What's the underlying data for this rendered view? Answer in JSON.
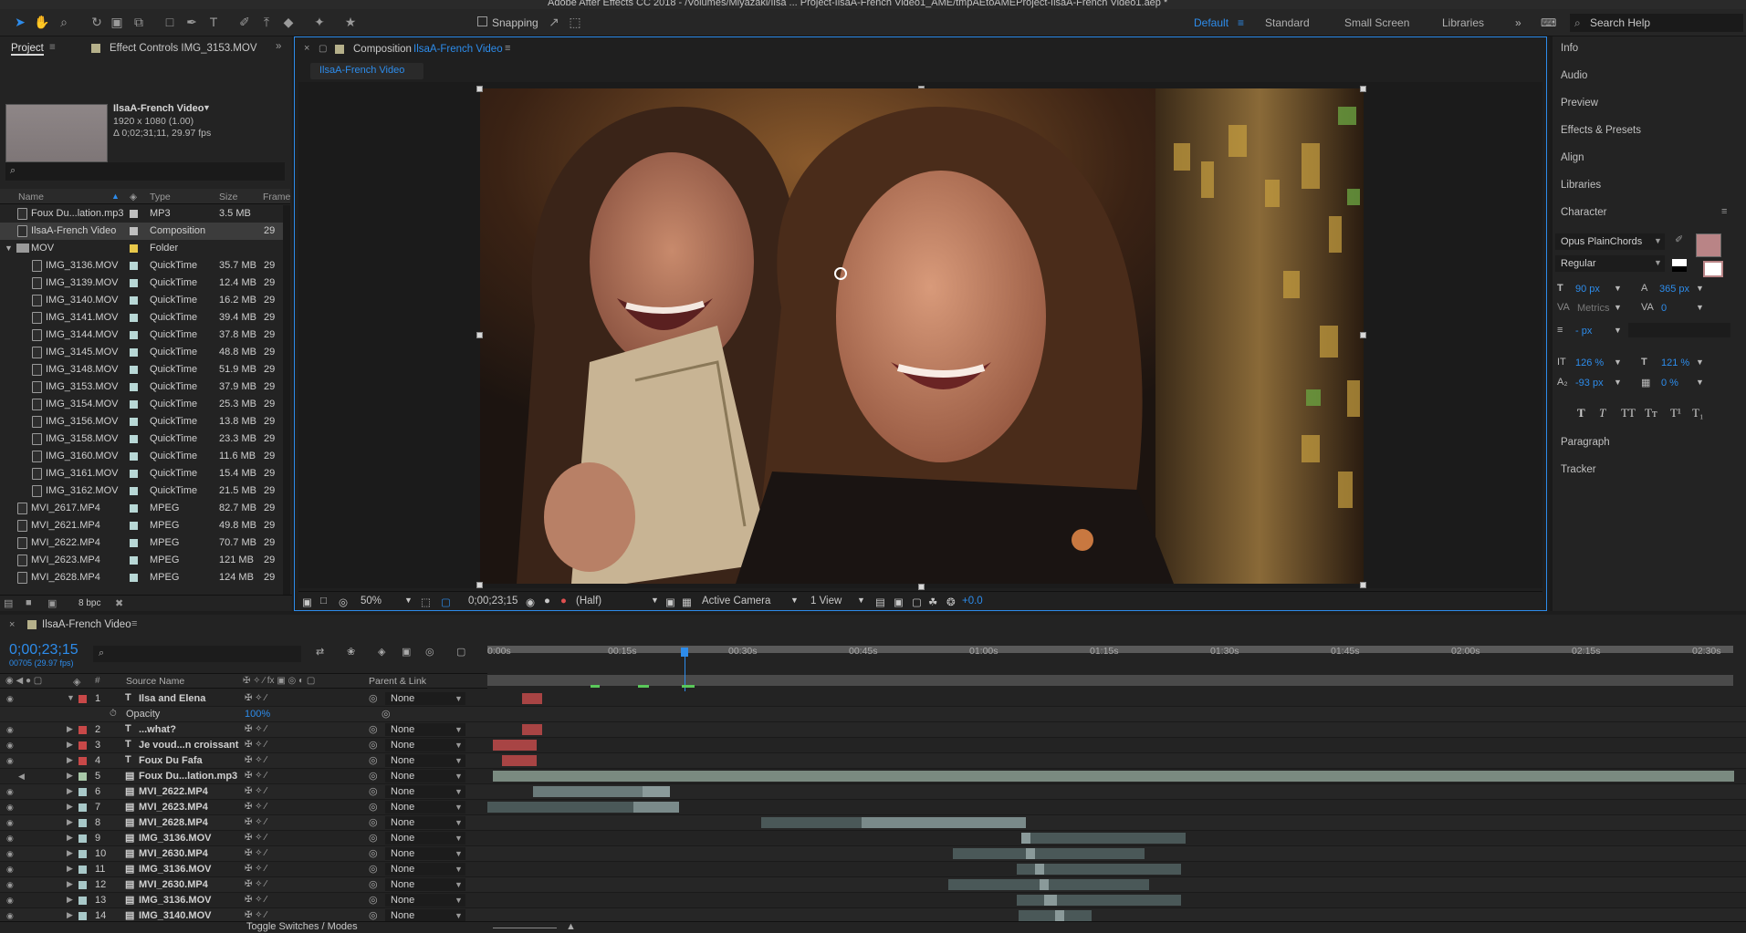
{
  "window_title": "Adobe After Effects CC 2018 - /Volumes/Miyazaki/Ilsa ... Project-IlsaA-French Video1_AME/tmpAEtoAMEProject-IlsaA-French Video1.aep *",
  "toolbar": {
    "snapping_label": "Snapping"
  },
  "workspaces": {
    "items": [
      "Default",
      "Standard",
      "Small Screen",
      "Libraries"
    ],
    "active": "Default"
  },
  "search_help": "Search Help",
  "project": {
    "tab_project": "Project",
    "tab_effect_controls": "Effect Controls IMG_3153.MOV",
    "selected_name": "IlsaA-French Video",
    "selected_dims": "1920 x 1080 (1.00)",
    "selected_duration": "Δ 0;02;31;11, 29.97 fps",
    "columns": {
      "name": "Name",
      "type": "Type",
      "size": "Size",
      "frame": "Frame"
    },
    "bpc": "8 bpc",
    "items": [
      {
        "name": "Foux Du...lation.mp3",
        "type": "MP3",
        "size": "3.5 MB",
        "frame": "",
        "color": "#bfbfbf",
        "indent": 0
      },
      {
        "name": "IlsaA-French Video",
        "type": "Composition",
        "size": "",
        "frame": "29",
        "color": "#bfbfbf",
        "indent": 0,
        "selected": true
      },
      {
        "name": "MOV",
        "type": "Folder",
        "size": "",
        "frame": "",
        "color": "#e8c84a",
        "indent": 0,
        "folder": true
      },
      {
        "name": "IMG_3136.MOV",
        "type": "QuickTime",
        "size": "35.7 MB",
        "frame": "29",
        "color": "#b8d8d6",
        "indent": 1
      },
      {
        "name": "IMG_3139.MOV",
        "type": "QuickTime",
        "size": "12.4 MB",
        "frame": "29",
        "color": "#b8d8d6",
        "indent": 1
      },
      {
        "name": "IMG_3140.MOV",
        "type": "QuickTime",
        "size": "16.2 MB",
        "frame": "29",
        "color": "#b8d8d6",
        "indent": 1
      },
      {
        "name": "IMG_3141.MOV",
        "type": "QuickTime",
        "size": "39.4 MB",
        "frame": "29",
        "color": "#b8d8d6",
        "indent": 1
      },
      {
        "name": "IMG_3144.MOV",
        "type": "QuickTime",
        "size": "37.8 MB",
        "frame": "29",
        "color": "#b8d8d6",
        "indent": 1
      },
      {
        "name": "IMG_3145.MOV",
        "type": "QuickTime",
        "size": "48.8 MB",
        "frame": "29",
        "color": "#b8d8d6",
        "indent": 1
      },
      {
        "name": "IMG_3148.MOV",
        "type": "QuickTime",
        "size": "51.9 MB",
        "frame": "29",
        "color": "#b8d8d6",
        "indent": 1
      },
      {
        "name": "IMG_3153.MOV",
        "type": "QuickTime",
        "size": "37.9 MB",
        "frame": "29",
        "color": "#b8d8d6",
        "indent": 1
      },
      {
        "name": "IMG_3154.MOV",
        "type": "QuickTime",
        "size": "25.3 MB",
        "frame": "29",
        "color": "#b8d8d6",
        "indent": 1
      },
      {
        "name": "IMG_3156.MOV",
        "type": "QuickTime",
        "size": "13.8 MB",
        "frame": "29",
        "color": "#b8d8d6",
        "indent": 1
      },
      {
        "name": "IMG_3158.MOV",
        "type": "QuickTime",
        "size": "23.3 MB",
        "frame": "29",
        "color": "#b8d8d6",
        "indent": 1
      },
      {
        "name": "IMG_3160.MOV",
        "type": "QuickTime",
        "size": "11.6 MB",
        "frame": "29",
        "color": "#b8d8d6",
        "indent": 1
      },
      {
        "name": "IMG_3161.MOV",
        "type": "QuickTime",
        "size": "15.4 MB",
        "frame": "29",
        "color": "#b8d8d6",
        "indent": 1
      },
      {
        "name": "IMG_3162.MOV",
        "type": "QuickTime",
        "size": "21.5 MB",
        "frame": "29",
        "color": "#b8d8d6",
        "indent": 1
      },
      {
        "name": "MVI_2617.MP4",
        "type": "MPEG",
        "size": "82.7 MB",
        "frame": "29",
        "color": "#b8d8d6",
        "indent": 0
      },
      {
        "name": "MVI_2621.MP4",
        "type": "MPEG",
        "size": "49.8 MB",
        "frame": "29",
        "color": "#b8d8d6",
        "indent": 0
      },
      {
        "name": "MVI_2622.MP4",
        "type": "MPEG",
        "size": "70.7 MB",
        "frame": "29",
        "color": "#b8d8d6",
        "indent": 0
      },
      {
        "name": "MVI_2623.MP4",
        "type": "MPEG",
        "size": "121 MB",
        "frame": "29",
        "color": "#b8d8d6",
        "indent": 0
      },
      {
        "name": "MVI_2628.MP4",
        "type": "MPEG",
        "size": "124 MB",
        "frame": "29",
        "color": "#b8d8d6",
        "indent": 0
      }
    ]
  },
  "composition": {
    "tab_prefix": "Composition",
    "name": "IlsaA-French Video",
    "breadcrumb": "IlsaA-French Video",
    "zoom": "50%",
    "timecode": "0;00;23;15",
    "resolution": "(Half)",
    "camera": "Active Camera",
    "views": "1 View",
    "exposure": "+0.0"
  },
  "right_panel": {
    "items": [
      "Info",
      "Audio",
      "Preview",
      "Effects & Presets",
      "Align",
      "Libraries",
      "Character",
      "Paragraph",
      "Tracker"
    ],
    "character": {
      "font": "Opus PlainChords",
      "style": "Regular",
      "font_size": "90 px",
      "leading": "365 px",
      "kerning": "Metrics",
      "tracking": "0",
      "stroke": "- px",
      "vert_scale": "126 %",
      "horiz_scale": "121 %",
      "baseline": "-93 px",
      "tsume": "0 %",
      "fill_color": "#b98486"
    }
  },
  "timeline": {
    "tab": "IlsaA-French Video",
    "timecode": "0;00;23;15",
    "frames": "00705 (29.97 fps)",
    "col_source": "Source Name",
    "col_parent": "Parent & Link",
    "toggle_label": "Toggle Switches / Modes",
    "ruler": [
      "0:00s",
      "00:15s",
      "00:30s",
      "00:45s",
      "01:00s",
      "01:15s",
      "01:30s",
      "01:45s",
      "02:00s",
      "02:15s",
      "02:30s"
    ],
    "opacity_label": "Opacity",
    "opacity_value": "100%",
    "layers": [
      {
        "num": "1",
        "name": "Ilsa and Elena",
        "kind": "T",
        "parent": "None",
        "color": "#c84848",
        "expanded": true
      },
      {
        "num": "2",
        "name": "...what?",
        "kind": "T",
        "parent": "None",
        "color": "#c84848"
      },
      {
        "num": "3",
        "name": "Je voud...n croissant",
        "kind": "T",
        "parent": "None",
        "color": "#c84848"
      },
      {
        "num": "4",
        "name": "Foux Du Fafa",
        "kind": "T",
        "parent": "None",
        "color": "#c84848"
      },
      {
        "num": "5",
        "name": "Foux Du...lation.mp3",
        "kind": "A",
        "parent": "None",
        "color": "#a8c8a8"
      },
      {
        "num": "6",
        "name": "MVI_2622.MP4",
        "kind": "V",
        "parent": "None",
        "color": "#a8c8c8"
      },
      {
        "num": "7",
        "name": "MVI_2623.MP4",
        "kind": "V",
        "parent": "None",
        "color": "#a8c8c8"
      },
      {
        "num": "8",
        "name": "MVI_2628.MP4",
        "kind": "V",
        "parent": "None",
        "color": "#a8c8c8"
      },
      {
        "num": "9",
        "name": "IMG_3136.MOV",
        "kind": "V",
        "parent": "None",
        "color": "#a8c8c8"
      },
      {
        "num": "10",
        "name": "MVI_2630.MP4",
        "kind": "V",
        "parent": "None",
        "color": "#a8c8c8"
      },
      {
        "num": "11",
        "name": "IMG_3136.MOV",
        "kind": "V",
        "parent": "None",
        "color": "#a8c8c8"
      },
      {
        "num": "12",
        "name": "MVI_2630.MP4",
        "kind": "V",
        "parent": "None",
        "color": "#a8c8c8"
      },
      {
        "num": "13",
        "name": "IMG_3136.MOV",
        "kind": "V",
        "parent": "None",
        "color": "#a8c8c8"
      },
      {
        "num": "14",
        "name": "IMG_3140.MOV",
        "kind": "V",
        "parent": "None",
        "color": "#a8c8c8"
      }
    ]
  }
}
